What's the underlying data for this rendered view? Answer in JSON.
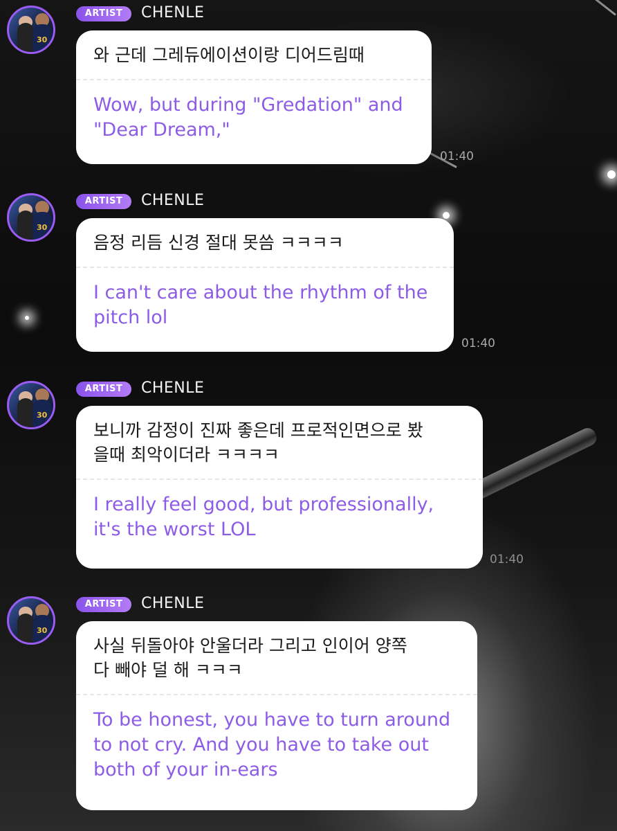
{
  "messages": [
    {
      "badge": "ARTIST",
      "name": "CHENLE",
      "avatar_number": "30",
      "korean": "와 근데 그레듀에이션이랑 디어드림때",
      "english": "Wow, but during \"Gredation\" and\n\"Dear Dream,\"",
      "time": "01:40"
    },
    {
      "badge": "ARTIST",
      "name": "CHENLE",
      "avatar_number": "30",
      "korean": "음정 리듬 신경 절대 못씀 ㅋㅋㅋㅋ",
      "english": "I can't care about the rhythm of the\npitch lol",
      "time": "01:40"
    },
    {
      "badge": "ARTIST",
      "name": "CHENLE",
      "avatar_number": "30",
      "korean": "보니까 감정이 진짜 좋은데 프로적인면으로 봤\n을때 최악이더라 ㅋㅋㅋㅋ",
      "english": "I really feel good, but professionally,\nit's the worst LOL",
      "time": "01:40"
    },
    {
      "badge": "ARTIST",
      "name": "CHENLE",
      "avatar_number": "30",
      "korean": "사실 뒤돌아야 안울더라 그리고 인이어 양쪽\n다 빼야 덜 해 ㅋㅋㅋ",
      "english": "To be honest, you have to turn around\nto not cry. And you have to take out\nboth of your in-ears"
    }
  ],
  "colors": {
    "badge": "#9a5cf2",
    "translation": "#8d5ce6",
    "bubble": "#ffffff",
    "background": "#111111"
  },
  "icons": [
    "artist-avatar"
  ]
}
